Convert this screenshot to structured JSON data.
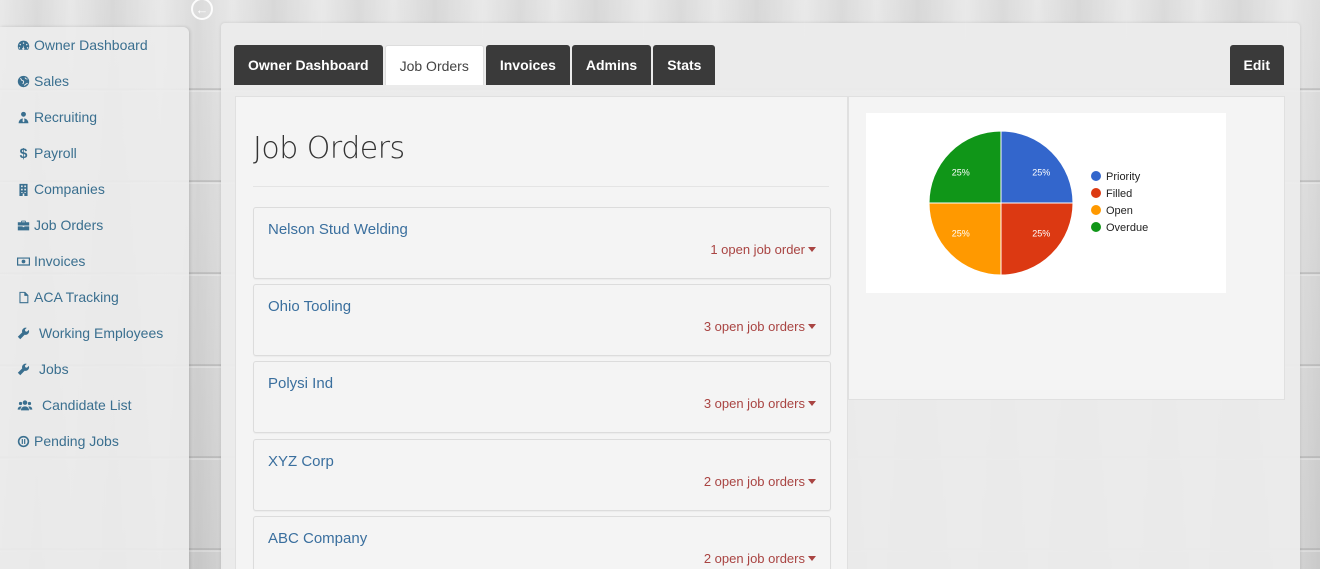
{
  "sidebar": {
    "items": [
      {
        "label": "Owner Dashboard",
        "icon": "dashboard-icon"
      },
      {
        "label": "Sales",
        "icon": "globe-icon"
      },
      {
        "label": "Recruiting",
        "icon": "user-tie-icon"
      },
      {
        "label": "Payroll",
        "icon": "dollar-icon"
      },
      {
        "label": "Companies",
        "icon": "building-icon"
      },
      {
        "label": "Job Orders",
        "icon": "briefcase-icon"
      },
      {
        "label": "Invoices",
        "icon": "money-icon"
      },
      {
        "label": "ACA Tracking",
        "icon": "file-icon"
      },
      {
        "label": "Working Employees",
        "icon": "wrench-icon"
      },
      {
        "label": "Jobs",
        "icon": "wrench-icon"
      },
      {
        "label": "Candidate List",
        "icon": "users-icon"
      },
      {
        "label": "Pending Jobs",
        "icon": "pause-circle-icon"
      }
    ]
  },
  "tabs": [
    {
      "label": "Owner Dashboard",
      "active": false
    },
    {
      "label": "Job Orders",
      "active": true
    },
    {
      "label": "Invoices",
      "active": false
    },
    {
      "label": "Admins",
      "active": false
    },
    {
      "label": "Stats",
      "active": false
    }
  ],
  "edit_label": "Edit",
  "page_title": "Job Orders",
  "companies": [
    {
      "name": "Nelson Stud Welding",
      "orders": "1 open job order"
    },
    {
      "name": "Ohio Tooling",
      "orders": "3 open job orders"
    },
    {
      "name": "Polysi Ind",
      "orders": "3 open job orders"
    },
    {
      "name": "XYZ Corp",
      "orders": "2 open job orders"
    },
    {
      "name": "ABC Company",
      "orders": "2 open job orders"
    }
  ],
  "colors": {
    "link": "#3a6f9e",
    "orders": "#a94442",
    "tab_dark": "#3a3a3a"
  },
  "chart_data": {
    "type": "pie",
    "labels": [
      "Priority",
      "Filled",
      "Open",
      "Overdue"
    ],
    "values": [
      25,
      25,
      25,
      25
    ],
    "slice_labels": [
      "25%",
      "25%",
      "25%",
      "25%"
    ],
    "colors": [
      "#3366cc",
      "#dc3912",
      "#ff9900",
      "#109618"
    ],
    "legend": "right"
  }
}
